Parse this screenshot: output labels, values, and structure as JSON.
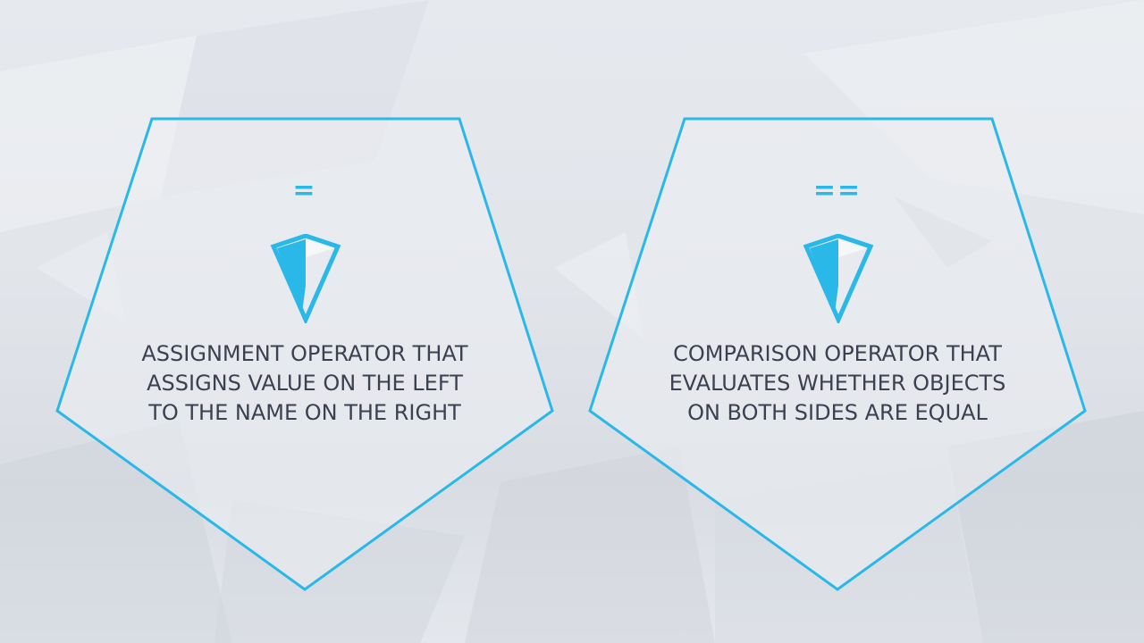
{
  "theme": {
    "accent": "#29b8e8",
    "text": "#3a4150",
    "background": "#e2e6eb"
  },
  "cards": [
    {
      "symbol": "=",
      "icon": "diamond-icon",
      "lines": [
        "ASSIGNMENT OPERATOR THAT",
        "ASSIGNS VALUE ON THE LEFT",
        "TO THE NAME ON THE RIGHT"
      ]
    },
    {
      "symbol": "==",
      "icon": "diamond-icon",
      "lines": [
        "COMPARISON OPERATOR THAT",
        "EVALUATES WHETHER OBJECTS",
        "ON BOTH SIDES ARE EQUAL"
      ]
    }
  ]
}
